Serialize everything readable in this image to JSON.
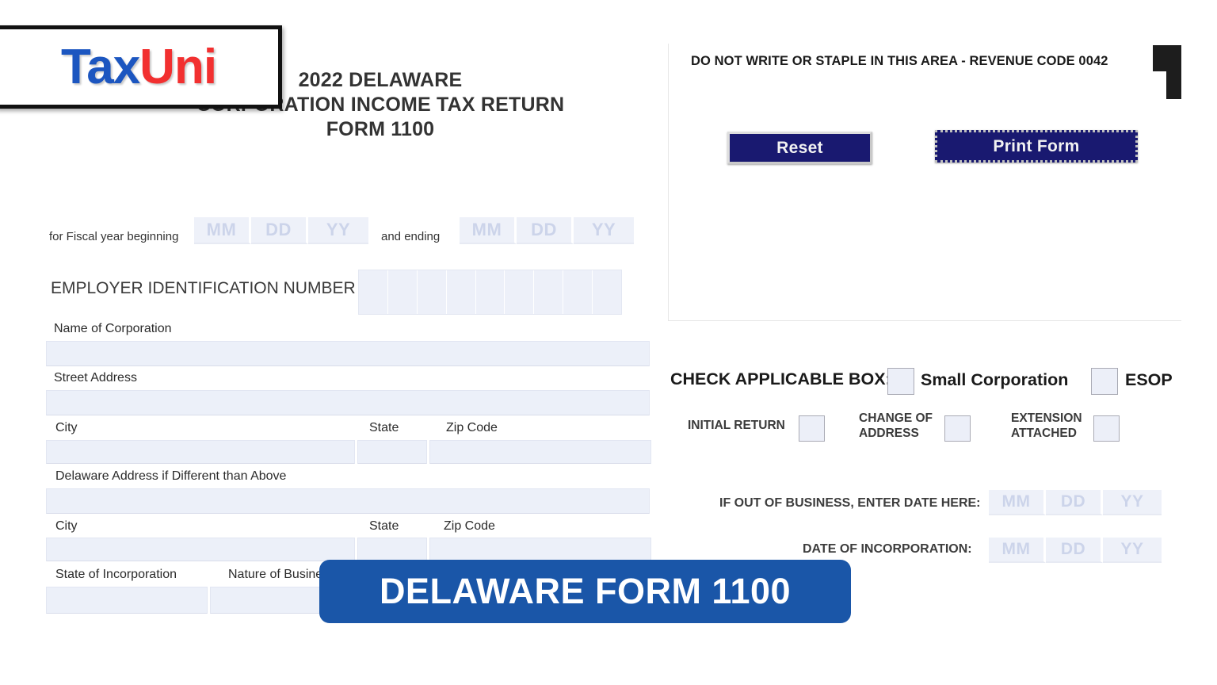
{
  "logo": {
    "part1": "Tax",
    "part2": "Uni",
    "color1": "#1c56c0",
    "color2": "#f23030"
  },
  "form": {
    "title_line1": "2022 DELAWARE",
    "title_line2": "CORPORATION INCOME TAX RETURN",
    "title_line3": "FORM 1100"
  },
  "header_right": {
    "no_write_note": "DO NOT WRITE OR STAPLE IN THIS AREA - REVENUE CODE 0042",
    "reset_label": "Reset",
    "print_label": "Print Form",
    "button_color": "#191970"
  },
  "fiscal_year": {
    "beginning_label": "for Fiscal year beginning",
    "ending_label": "and ending",
    "begin_mm": "MM",
    "begin_dd": "DD",
    "begin_yy": "YY",
    "end_mm": "MM",
    "end_dd": "DD",
    "end_yy": "YY",
    "begin_mm_value": "",
    "begin_dd_value": "",
    "begin_yy_value": "",
    "end_mm_value": "",
    "end_dd_value": "",
    "end_yy_value": ""
  },
  "ein": {
    "label": "EMPLOYER IDENTIFICATION NUMBER",
    "digits": [
      "",
      "",
      "",
      "",
      "",
      "",
      "",
      "",
      ""
    ]
  },
  "address": {
    "name_label": "Name of Corporation",
    "name_value": "",
    "street_label": "Street Address",
    "street_value": "",
    "city_label": "City",
    "city_value": "",
    "state_label": "State",
    "state_value": "",
    "zip_label": "Zip Code",
    "zip_value": "",
    "de_address_label": "Delaware Address if Different than Above",
    "de_address_value": "",
    "de_city_label": "City",
    "de_city_value": "",
    "de_state_label": "State",
    "de_state_value": "",
    "de_zip_label": "Zip Code",
    "de_zip_value": "",
    "state_incorp_label": "State of Incorporation",
    "state_incorp_value": "",
    "nature_business_label": "Nature of Business",
    "nature_business_value": ""
  },
  "checkboxes": {
    "heading": "CHECK APPLICABLE BOX:",
    "small_corporation": "Small Corporation",
    "esop": "ESOP",
    "initial_return": "INITIAL RETURN",
    "change_of_address_line1": "CHANGE OF",
    "change_of_address_line2": "ADDRESS",
    "extension_attached_line1": "EXTENSION",
    "extension_attached_line2": "ATTACHED"
  },
  "dates_right": {
    "out_of_business_label": "IF OUT OF BUSINESS, ENTER DATE HERE:",
    "oob_mm": "MM",
    "oob_dd": "DD",
    "oob_yy": "YY",
    "incorporation_label": "DATE OF INCORPORATION:",
    "inc_mm": "MM",
    "inc_dd": "DD",
    "inc_yy": "YY"
  },
  "banner": {
    "text": "DELAWARE FORM 1100",
    "color": "#1a56a8"
  }
}
